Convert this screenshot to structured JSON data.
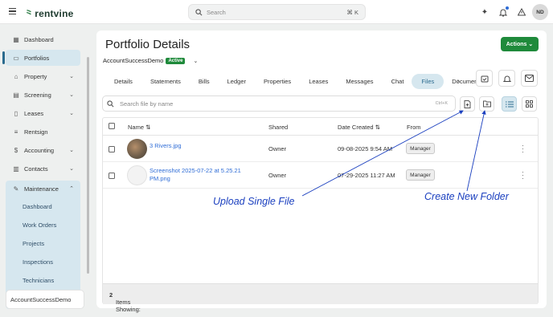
{
  "topbar": {
    "logo": "rentvine",
    "search_placeholder": "Search",
    "search_shortcut": "⌘ K",
    "avatar_initials": "ND"
  },
  "sidebar": {
    "items": [
      {
        "label": "Dashboard",
        "icon": "grid-icon"
      },
      {
        "label": "Portfolios",
        "icon": "folder-icon",
        "active": true
      },
      {
        "label": "Property",
        "icon": "house-icon"
      },
      {
        "label": "Screening",
        "icon": "clipboard-icon"
      },
      {
        "label": "Leases",
        "icon": "document-icon"
      },
      {
        "label": "Rentsign",
        "icon": "signature-icon"
      },
      {
        "label": "Accounting",
        "icon": "dollar-icon"
      },
      {
        "label": "Contacts",
        "icon": "book-icon"
      },
      {
        "label": "Maintenance",
        "icon": "wrench-icon",
        "expanded": true
      }
    ],
    "maintenance_sub": [
      "Dashboard",
      "Work Orders",
      "Projects",
      "Inspections",
      "Technicians"
    ],
    "account": "AccountSuccessDemo"
  },
  "page": {
    "title": "Portfolio Details",
    "actions_label": "Actions",
    "entity_name": "AccountSuccessDemo",
    "entity_status": "Active",
    "tabs": [
      "Details",
      "Statements",
      "Bills",
      "Ledger",
      "Properties",
      "Leases",
      "Messages",
      "Chat",
      "Files",
      "Documer"
    ],
    "active_tab": "Files"
  },
  "files": {
    "search_placeholder": "Search file by name",
    "search_shortcut": "Ctrl+K",
    "columns": {
      "name": "Name",
      "shared": "Shared",
      "date": "Date Created",
      "from": "From"
    },
    "rows": [
      {
        "name_line1": "3 Rivers.jpg",
        "name_line2": "",
        "shared": "Owner",
        "date": "09-08-2025 9:54 AM",
        "from": "Manager"
      },
      {
        "name_line1": "Screenshot 2025-07-22 at 5.25.21",
        "name_line2": "PM.png",
        "shared": "Owner",
        "date": "07-29-2025 11:27 AM",
        "from": "Manager"
      }
    ],
    "footer_label": "Items Showing:",
    "footer_count": "2"
  },
  "annotations": {
    "upload": "Upload  Single File",
    "folder": "Create New Folder"
  },
  "colors": {
    "brand_green": "#1f8a3b",
    "active_blue": "#d6e7ef",
    "annotation_blue": "#1a3fbf"
  }
}
